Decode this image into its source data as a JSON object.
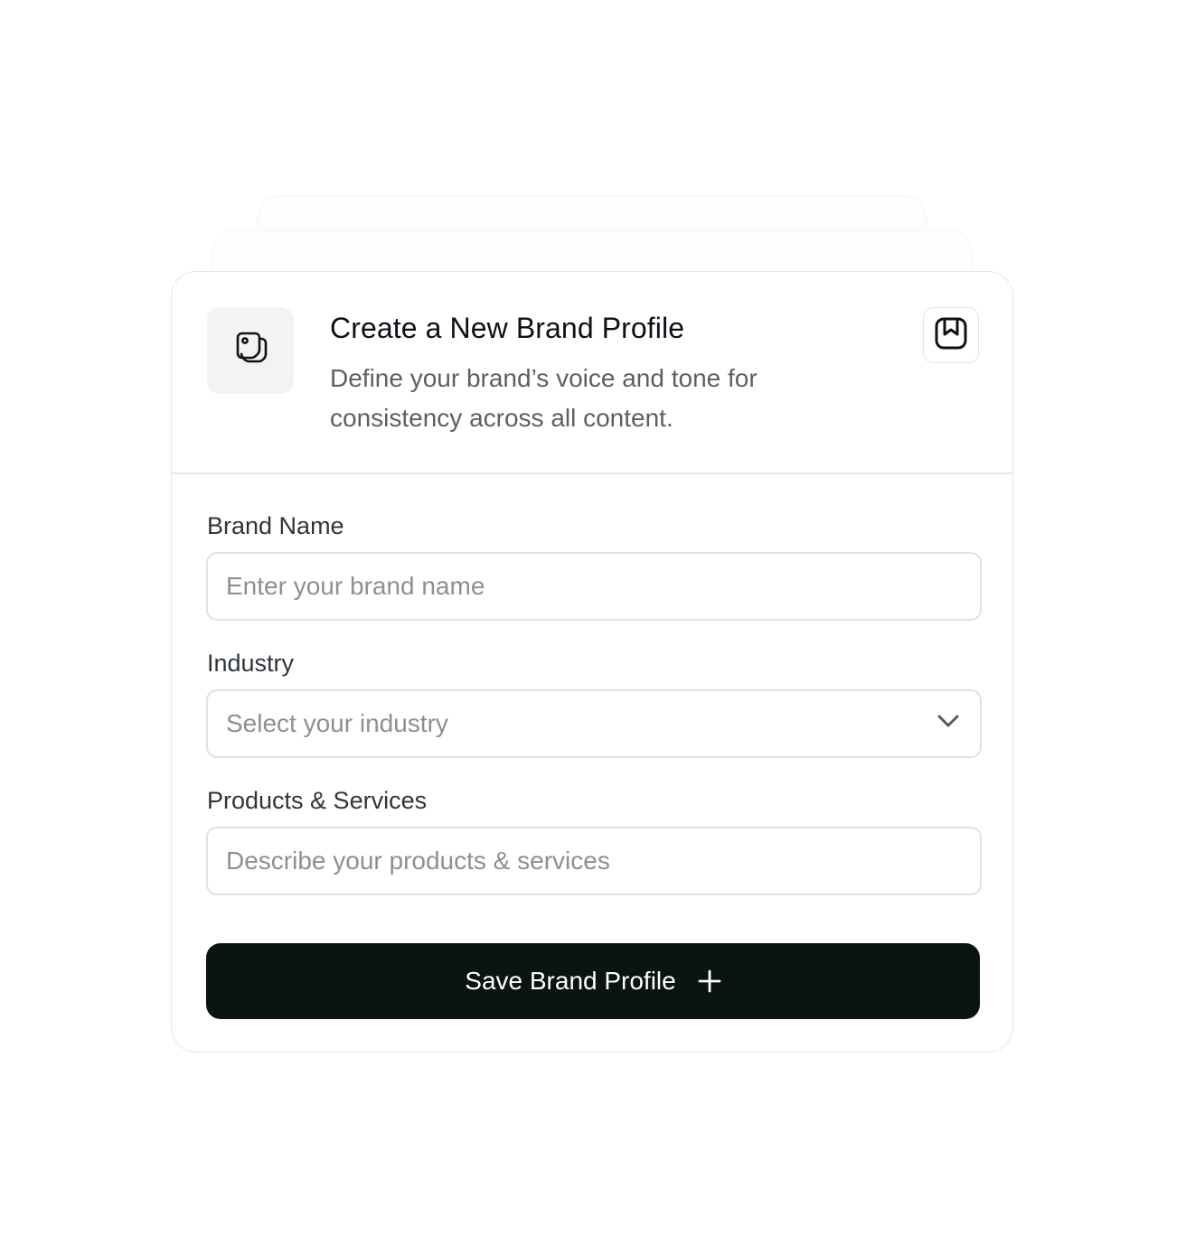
{
  "header": {
    "title": "Create a New Brand Profile",
    "description": "Define your brand’s voice and tone for consistency across all content.",
    "brand_icon": "sticker-icon",
    "bookmark_icon": "bookmark-icon"
  },
  "form": {
    "brand_name": {
      "label": "Brand Name",
      "placeholder": "Enter your brand name",
      "value": ""
    },
    "industry": {
      "label": "Industry",
      "selected": "Select your industry",
      "icon": "chevron-down-icon"
    },
    "products": {
      "label": "Products & Services",
      "placeholder": "Describe your products & services",
      "value": ""
    },
    "save_button": {
      "label": "Save Brand Profile",
      "icon": "plus-icon"
    }
  },
  "colors": {
    "button_bg": "#0a1412",
    "border": "#e6e8ea",
    "placeholder": "#8b9095"
  }
}
